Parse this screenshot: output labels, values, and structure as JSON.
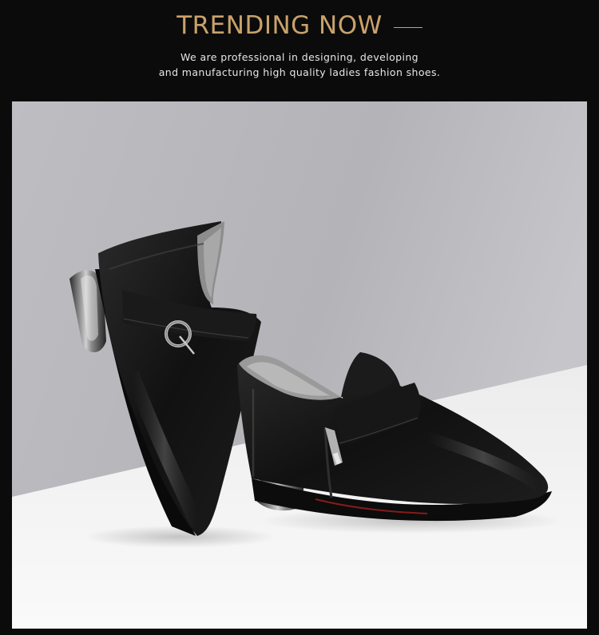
{
  "header": {
    "title": "TRENDING NOW",
    "tagline_line1": "We are professional in designing, developing",
    "tagline_line2": "and manufacturing high quality ladies fashion shoes."
  },
  "photo": {
    "subject": "pair-of-black-leather-ankle-boots",
    "colors": {
      "page_bg": "#0b0b0b",
      "accent_gold": "#c9a26b",
      "wall": "#b6b6bb",
      "floor": "#f4f4f4",
      "leather": "#161616"
    }
  }
}
